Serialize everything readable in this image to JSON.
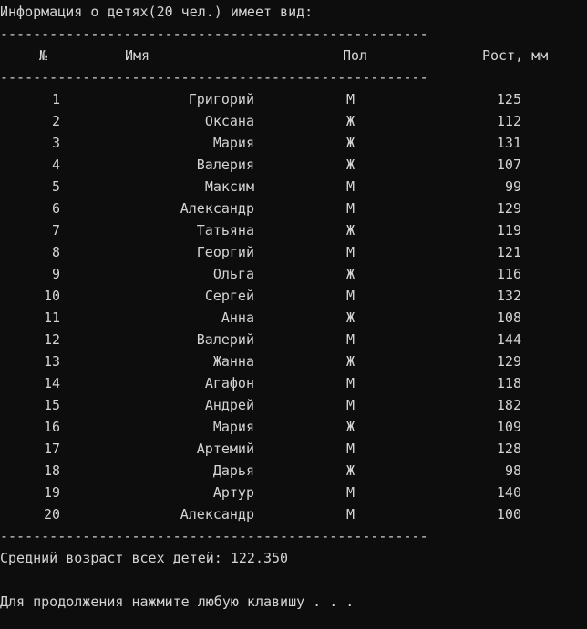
{
  "terminal": {
    "background_color": "#0d0d0d",
    "text_color": "#d4d4d4",
    "title": "Информация о детях(20 чел.) имеет вид:",
    "separator": "----------------------------------------------------",
    "columns": {
      "number": "№",
      "name": "Имя",
      "sex": "Пол",
      "height": "Рост, мм"
    },
    "rows": [
      {
        "number": "1",
        "name": "Григорий",
        "sex": "М",
        "height": "125"
      },
      {
        "number": "2",
        "name": "Оксана",
        "sex": "Ж",
        "height": "112"
      },
      {
        "number": "3",
        "name": "Мария",
        "sex": "Ж",
        "height": "131"
      },
      {
        "number": "4",
        "name": "Валерия",
        "sex": "Ж",
        "height": "107"
      },
      {
        "number": "5",
        "name": "Максим",
        "sex": "М",
        "height": "99"
      },
      {
        "number": "6",
        "name": "Александр",
        "sex": "М",
        "height": "129"
      },
      {
        "number": "7",
        "name": "Татьяна",
        "sex": "Ж",
        "height": "119"
      },
      {
        "number": "8",
        "name": "Георгий",
        "sex": "М",
        "height": "121"
      },
      {
        "number": "9",
        "name": "Ольга",
        "sex": "Ж",
        "height": "116"
      },
      {
        "number": "10",
        "name": "Сергей",
        "sex": "М",
        "height": "132"
      },
      {
        "number": "11",
        "name": "Анна",
        "sex": "Ж",
        "height": "108"
      },
      {
        "number": "12",
        "name": "Валерий",
        "sex": "М",
        "height": "144"
      },
      {
        "number": "13",
        "name": "Жанна",
        "sex": "Ж",
        "height": "129"
      },
      {
        "number": "14",
        "name": "Агафон",
        "sex": "М",
        "height": "118"
      },
      {
        "number": "15",
        "name": "Андрей",
        "sex": "М",
        "height": "182"
      },
      {
        "number": "16",
        "name": "Мария",
        "sex": "Ж",
        "height": "109"
      },
      {
        "number": "17",
        "name": "Артемий",
        "sex": "М",
        "height": "128"
      },
      {
        "number": "18",
        "name": "Дарья",
        "sex": "Ж",
        "height": "98"
      },
      {
        "number": "19",
        "name": "Артур",
        "sex": "М",
        "height": "140"
      },
      {
        "number": "20",
        "name": "Александр",
        "sex": "М",
        "height": "100"
      }
    ],
    "summary": "Средний возраст всех детей: 122.350",
    "prompt": "Для продолжения нажмите любую клавишу . . ."
  }
}
